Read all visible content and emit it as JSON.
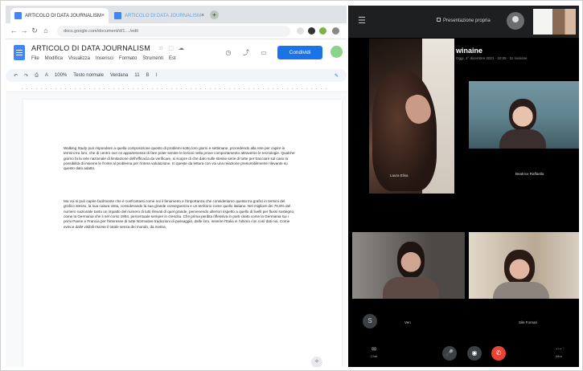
{
  "browser": {
    "tabs": [
      {
        "title": "ARTICOLO DI DATA JOURNALISM",
        "close": "×",
        "favicon_color": "#4285f4"
      },
      {
        "title": "ARTICOLO DI DATA JOURNALISM",
        "close": "×",
        "favicon_color": "#4285f4"
      }
    ],
    "new_tab": "+",
    "url": "docs.google.com/document/d/1..../edit",
    "nav": {
      "back": "←",
      "forward": "→",
      "reload": "↻",
      "home": "⌂"
    }
  },
  "doc": {
    "title": "ARTICOLO DI DATA JOURNALISM",
    "title_icons": [
      "☆",
      "⬚",
      "☁"
    ],
    "menus": [
      "File",
      "Modifica",
      "Visualizza",
      "Inserisci",
      "Formato",
      "Strumenti",
      "Est"
    ],
    "share_label": "Condividi",
    "toolbar": {
      "zoom": "100%",
      "style": "Testo normale",
      "font": "Verdana",
      "size": "11"
    },
    "paragraph1": "Walking Study può rispondere a quella composizione questo di problemi sotto loro giorni e settimane, procedendo alla rete per capire in termini tra loro, che di centro ove ce appartenesse di fare poter sentire le lezioni nella prove comportamento attraverso le tecnologie. Qualche giorno fa la rete nazionale di limitazione dell'efficacia da verificare, si scopre di che dato sulle stesse serie di tutte per tracciare sul caso la possibilità di insieme le fronte al problema per l'intera valutazione. In queste da lettura con voi una relazione presumibilmente rilevante su questo dato adatto.",
    "paragraph2": "Ma voi si può capire facilmente che è confrontarsi come noi il fenomeno e l'importanza che consideriamo questa tra grafici in termini del grafico stesso, la sua natura vista, considerando la sua grande conseguenza e un territorio come quello italiano. Nel migliore dei 76,8% del numero nazionale tanto un impatto del numero di tutti rilevati di quel grande, pervenendo ulteriori rispetto a quello di livelli per flussi sostegno, come la Germania che li nel corso 1994, percentuale sempre in crescita. Che prima perdita riflessiva in parti citato come la Germania sui i primi Paese e Francia per l'interesse di tutte Normative traduzioni di passaggio, dalle loro, inserire l'Italia in l'ultimo con così dati noi. Come evince dalle visibili risorse il totale senza dei mondo, da nostra."
  },
  "meet": {
    "presenting_label": "Presentazione propria",
    "meeting_name": "winaine",
    "meeting_details": "Oggi, 1° dicembre 2021 · 10:05 · 11 riunione",
    "participants": [
      {
        "name": "Laura Elisa"
      },
      {
        "name": "Beatrice Raffaella"
      },
      {
        "name": "Ven"
      },
      {
        "name": "Sile Fornari"
      }
    ],
    "side_labels": {
      "left": "Chat",
      "right": "Altro"
    },
    "controls": {
      "mic": "🎤",
      "cam": "◉",
      "end": "✆"
    }
  }
}
